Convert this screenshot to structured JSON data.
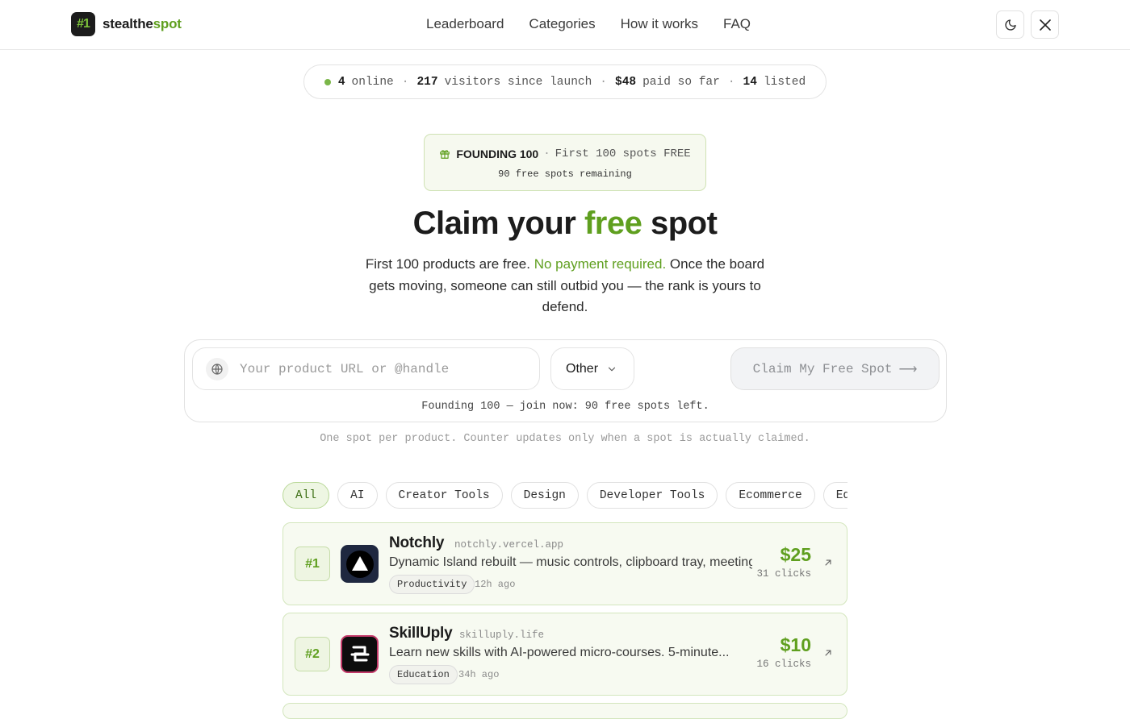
{
  "nav": {
    "logo_badge": "#1",
    "logo_text_a": "stealthe",
    "logo_text_b": "spot",
    "links": [
      "Leaderboard",
      "Categories",
      "How it works",
      "FAQ"
    ],
    "theme_icon": "moon-icon",
    "social_icon": "x-icon"
  },
  "stats": {
    "online_count": "4",
    "online_label": "online",
    "visitors_count": "217",
    "visitors_label": "visitors since launch",
    "paid_amount": "$48",
    "paid_label": "paid so far",
    "listed_count": "14",
    "listed_label": "listed",
    "separator": "·"
  },
  "founding": {
    "title": "FOUNDING 100",
    "separator": "·",
    "subtitle": "First 100 spots FREE",
    "remaining": "90 free spots remaining"
  },
  "hero": {
    "title_a": "Claim your ",
    "title_green": "free",
    "title_b": " spot",
    "sub_a": "First 100 products are free. ",
    "sub_green": "No payment required.",
    "sub_b": " Once the board gets moving, someone can still outbid you — the rank is yours to defend."
  },
  "form": {
    "url_placeholder": "Your product URL or @handle",
    "category_value": "Other",
    "claim_label": "Claim My Free Spot",
    "claim_arrow": "⟶",
    "note": "Founding 100 — join now: 90 free spots left.",
    "sub_note": "One spot per product. Counter updates only when a spot is actually claimed."
  },
  "categories": [
    "All",
    "AI",
    "Creator Tools",
    "Design",
    "Developer Tools",
    "Ecommerce",
    "Education"
  ],
  "listings": [
    {
      "rank": "#1",
      "name": "Notchly",
      "domain": "notchly.vercel.app",
      "description": "Dynamic Island rebuilt — music controls, clipboard tray, meeting...",
      "tag": "Productivity",
      "ago": "12h ago",
      "price": "$25",
      "clicks": "31 clicks"
    },
    {
      "rank": "#2",
      "name": "SkillUply",
      "domain": "skilluply.life",
      "description": "Learn new skills with AI-powered micro-courses. 5-minute...",
      "tag": "Education",
      "ago": "34h ago",
      "price": "$10",
      "clicks": "16 clicks"
    }
  ],
  "colors": {
    "accent_green": "#5f9f1f",
    "card_bg": "#f7faf1",
    "card_border": "#d3e6bd",
    "online_dot": "#7ab648"
  }
}
